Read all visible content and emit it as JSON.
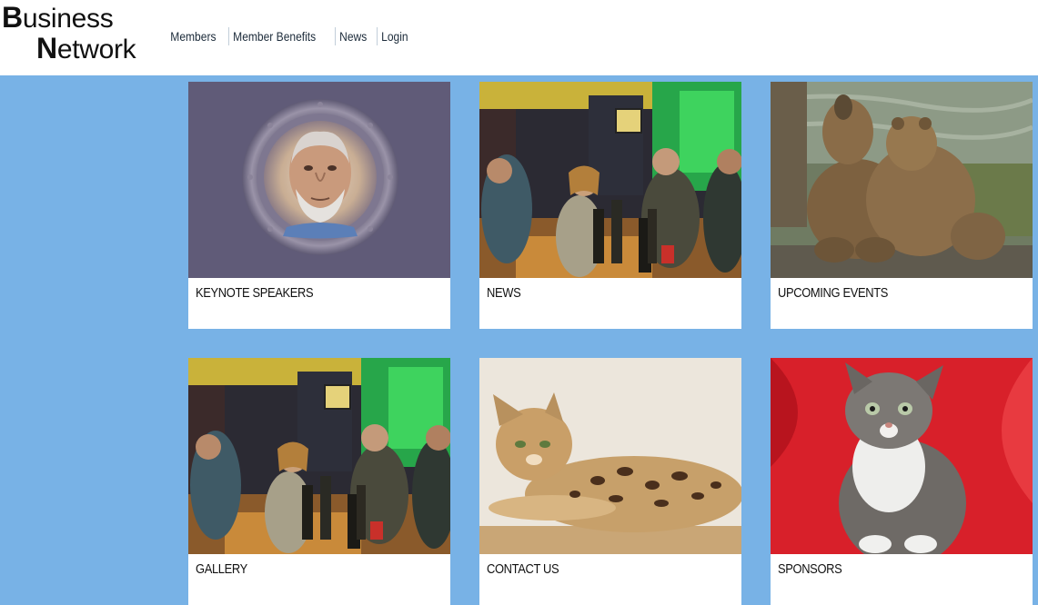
{
  "brand": {
    "line1_initial": "B",
    "line1_rest": "usiness",
    "line2_initial": "N",
    "line2_rest": "etwork"
  },
  "nav": {
    "items": [
      {
        "label": "Members"
      },
      {
        "label": "Member Benefits"
      },
      {
        "label": "News"
      },
      {
        "label": "Login"
      }
    ]
  },
  "cards": [
    {
      "title": "KEYNOTE SPEAKERS",
      "image": "portrait-porthole"
    },
    {
      "title": "NEWS",
      "image": "bar-scene"
    },
    {
      "title": "UPCOMING EVENTS",
      "image": "bear-cubs"
    },
    {
      "title": "GALLERY",
      "image": "bar-scene"
    },
    {
      "title": "CONTACT US",
      "image": "bengal-cat"
    },
    {
      "title": "SPONSORS",
      "image": "kitten-red"
    }
  ],
  "colors": {
    "page_background": "#78b2e6",
    "header_background": "#ffffff",
    "card_background": "#ffffff"
  }
}
